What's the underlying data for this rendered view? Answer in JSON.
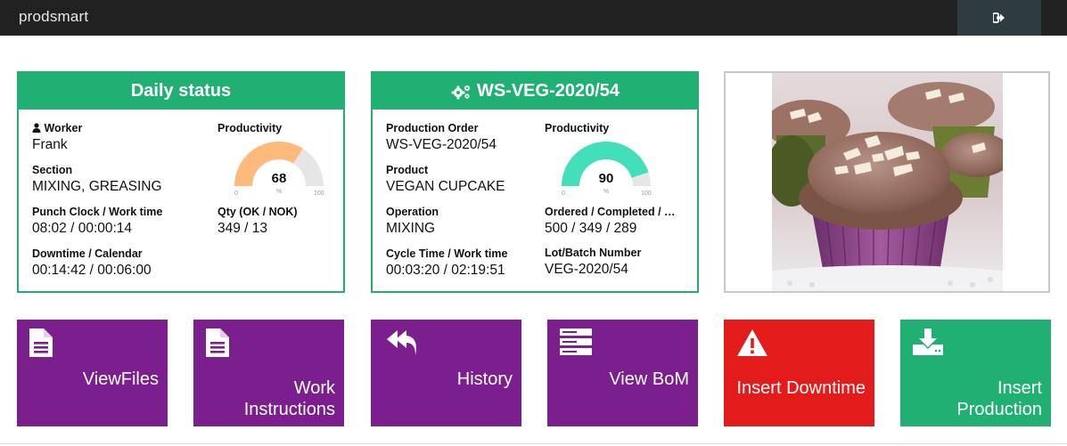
{
  "app": {
    "brand": "prodsmart"
  },
  "colors": {
    "accent_green": "#21b073",
    "tile_purple": "#7b1f8e",
    "tile_red": "#e31b1b",
    "topbar": "#212121",
    "gauge_orange": "#fdba7a",
    "gauge_teal": "#42dfba"
  },
  "header": {
    "logout_icon": "sign-out-icon"
  },
  "daily_status": {
    "title": "Daily status",
    "worker_label": "Worker",
    "worker_value": "Frank",
    "section_label": "Section",
    "section_value": "MIXING, GREASING",
    "punch_label": "Punch Clock / Work time",
    "punch_value": "08:02 / 00:00:14",
    "downtime_label": "Downtime / Calendar",
    "downtime_value": "00:14:42 / 00:06:00",
    "productivity_label": "Productivity",
    "productivity": {
      "value": 68,
      "display": "68",
      "unit": "%",
      "min": "0",
      "max": "100"
    },
    "qty_label": "Qty (OK / NOK)",
    "qty_value": "349 / 13"
  },
  "work_order": {
    "title": "WS-VEG-2020/54",
    "title_icon": "cogs-icon",
    "po_label": "Production Order",
    "po_value": "WS-VEG-2020/54",
    "product_label": "Product",
    "product_value": "VEGAN CUPCAKE",
    "operation_label": "Operation",
    "operation_value": "MIXING",
    "cycle_label": "Cycle Time / Work time",
    "cycle_value": "00:03:20 / 02:19:51",
    "productivity_label": "Productivity",
    "productivity": {
      "value": 90,
      "display": "90",
      "unit": "%",
      "min": "0",
      "max": "100"
    },
    "ordered_label": "Ordered / Completed / …",
    "ordered_value": "500 / 349 / 289",
    "lot_label": "Lot/Batch Number",
    "lot_value": "VEG-2020/54"
  },
  "product_image": {
    "subject": "vegan cupcakes with chocolate frosting and coconut flakes"
  },
  "tiles": [
    {
      "label": "ViewFiles",
      "icon": "file-icon",
      "color": "purple"
    },
    {
      "label_line1": "Work",
      "label_line2": "Instructions",
      "icon": "file-icon",
      "color": "purple"
    },
    {
      "label": "History",
      "icon": "reply-all-icon",
      "color": "purple"
    },
    {
      "label": "View BoM",
      "icon": "server-icon",
      "color": "purple"
    },
    {
      "label": "Insert Downtime",
      "icon": "warning-icon",
      "color": "red"
    },
    {
      "label_line1": "Insert",
      "label_line2": "Production",
      "icon": "download-icon",
      "color": "green"
    }
  ]
}
